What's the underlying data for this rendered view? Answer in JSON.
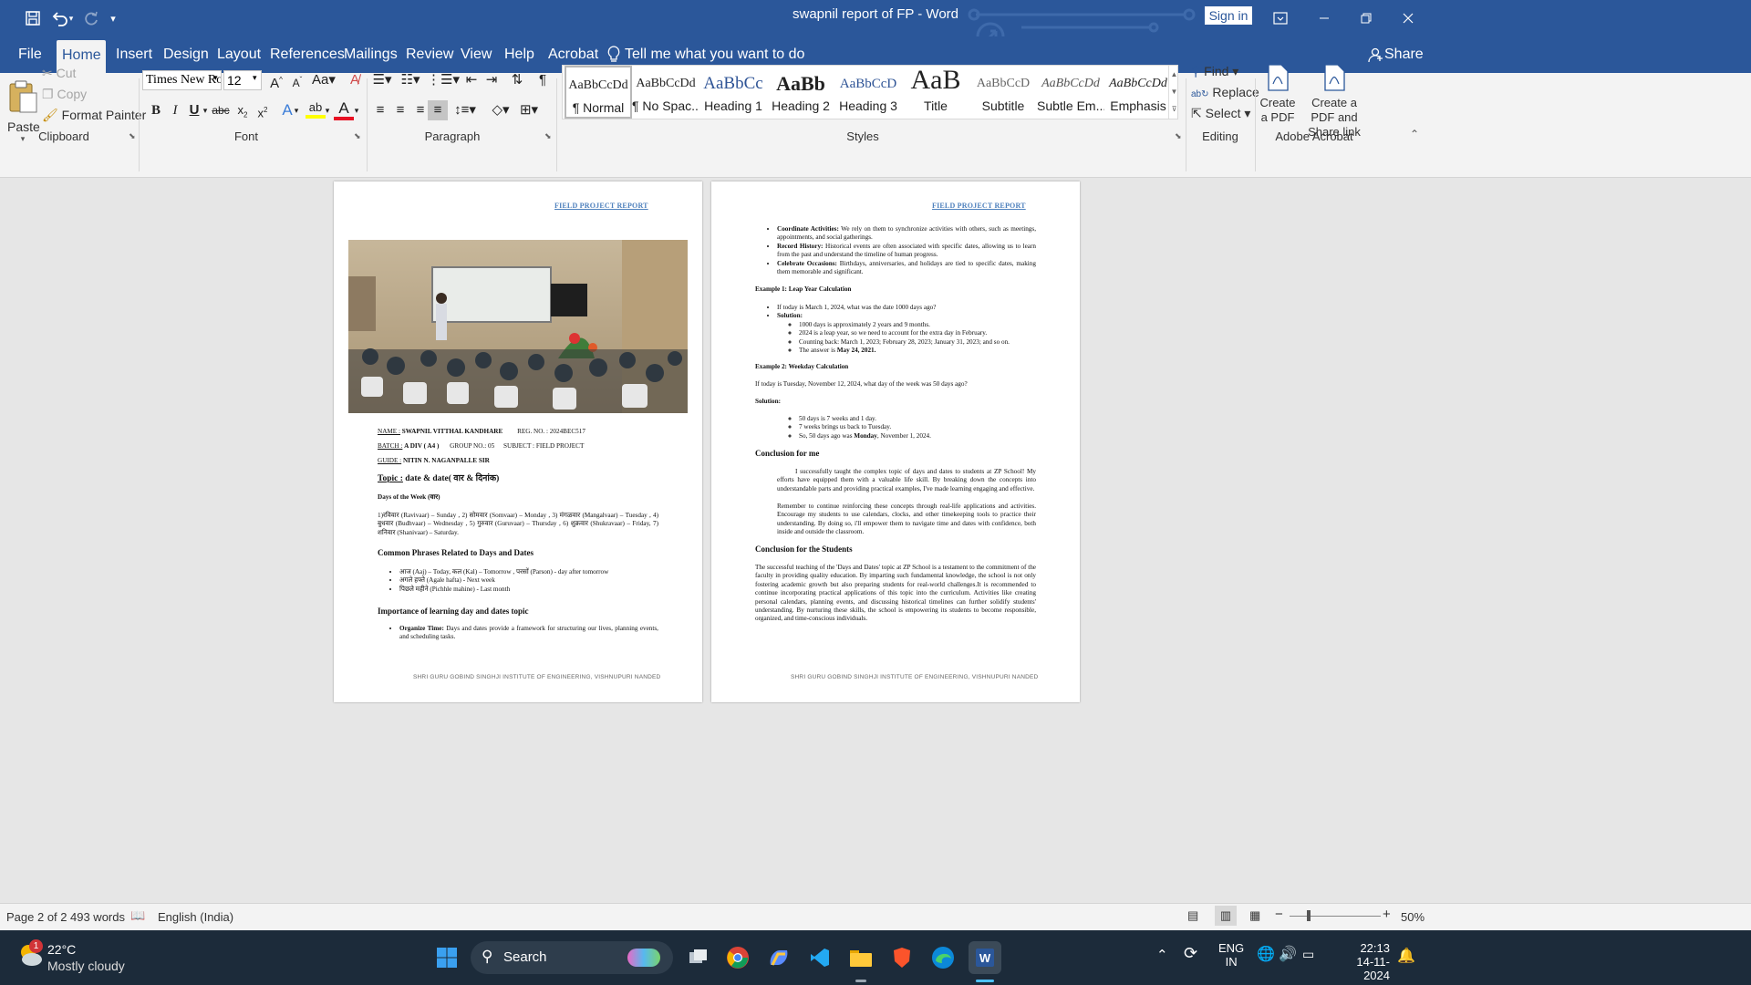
{
  "titlebar": {
    "title": "swapnil report of FP  -  Word",
    "sign_in": "Sign in"
  },
  "tabs": [
    "File",
    "Home",
    "Insert",
    "Design",
    "Layout",
    "References",
    "Mailings",
    "Review",
    "View",
    "Help",
    "Acrobat"
  ],
  "tell_me": "Tell me what you want to do",
  "share": "Share",
  "clipboard": {
    "paste": "Paste",
    "cut": "Cut",
    "copy": "Copy",
    "format_painter": "Format Painter",
    "label": "Clipboard"
  },
  "font": {
    "name": "Times New Ro",
    "size": "12",
    "label": "Font"
  },
  "paragraph": {
    "label": "Paragraph"
  },
  "styles": {
    "label": "Styles",
    "items": [
      {
        "preview": "AaBbCcDd",
        "name": "¶ Normal"
      },
      {
        "preview": "AaBbCcDd",
        "name": "¶ No Spac..."
      },
      {
        "preview": "AaBbCc",
        "name": "Heading 1"
      },
      {
        "preview": "AaBb",
        "name": "Heading 2"
      },
      {
        "preview": "AaBbCcD",
        "name": "Heading 3"
      },
      {
        "preview": "AaB",
        "name": "Title"
      },
      {
        "preview": "AaBbCcD",
        "name": "Subtitle"
      },
      {
        "preview": "AaBbCcDd",
        "name": "Subtle Em..."
      },
      {
        "preview": "AaBbCcDd",
        "name": "Emphasis"
      }
    ]
  },
  "editing": {
    "find": "Find",
    "replace": "Replace",
    "select": "Select",
    "label": "Editing"
  },
  "acrobat": {
    "create_pdf": "Create a PDF",
    "create_share": "Create a PDF and Share link",
    "label": "Adobe Acrobat"
  },
  "page1": {
    "header": "FIELD PROJECT  REPORT",
    "name_label": "NAME :",
    "name_value": "SWAPNIL VITTHAL KANDHARE",
    "reg": "REG. NO. : 2024BEC517",
    "batch_label": "BATCH :",
    "batch_value": "A DIV ( A4 )",
    "group": "GROUP NO.: 05",
    "subject": "SUBJECT : FIELD PROJECT",
    "guide_label": "GUIDE :",
    "guide_value": "NITIN N. NAGANPALLE SIR",
    "topic_label": "Topic :",
    "topic_value": "date & date( वार & दिनांक)",
    "days_heading": "Days of the Week (वार)",
    "days_text": "1)रविवार (Ravivaar) – Sunday , 2) सोमवार (Somvaar) – Monday , 3) मंगळवार (Mangalvaar) – Tuesday , 4) बुधवार (Budhvaar) – Wednesday , 5) गुरुवार (Guruvaar) – Thursday , 6) शुक्रवार (Shukravaar) – Friday, 7) शनिवार (Shanivaar) – Saturday.",
    "phrases_heading": "Common Phrases Related to Days and Dates",
    "phrases": [
      "आज (Aaj) – Today,  कल (Kal) – Tomorrow  , परसों (Parson) - day after tomorrow",
      "अगले हफ्ते (Agale hafta) - Next week",
      "पिछले महीने (Pichhle mahine) - Last month"
    ],
    "importance_heading": "Importance of learning day and dates topic",
    "organize_label": "Organize Time:",
    "organize_text": " Days and dates provide a framework for structuring our lives, planning events, and scheduling tasks.",
    "footer": "SHRI GURU GOBIND SINGHJI INSTITUTE OF ENGINEERING, VISHNUPURI NANDED"
  },
  "page2": {
    "header": "FIELD PROJECT  REPORT",
    "bullets": [
      {
        "label": "Coordinate Activities:",
        "text": " We rely on them to synchronize activities with others, such as meetings, appointments, and social gatherings."
      },
      {
        "label": "Record History:",
        "text": " Historical events are often associated with specific dates, allowing us to learn from the past and understand the timeline of human progress."
      },
      {
        "label": "Celebrate Occasions:",
        "text": " Birthdays, anniversaries, and holidays are tied to specific dates, making them memorable and significant."
      }
    ],
    "ex1_heading": "Example 1: Leap Year Calculation",
    "ex1_q": "If today is March 1, 2024, what was the date 1000 days ago?",
    "solution": "Solution:",
    "ex1_steps": [
      "1000 days is approximately 2 years and 9 months.",
      "2024 is a leap year, so we need to account for the extra day in February.",
      "Counting back: March 1, 2023; February 28, 2023; January 31, 2023; and so on."
    ],
    "ex1_answer_prefix": "The answer is ",
    "ex1_answer": "May 24, 2021.",
    "ex2_heading": "Example 2: Weekday Calculation",
    "ex2_q": "If today is Tuesday, November 12, 2024, what day of the week was 50 days ago?",
    "ex2_steps": [
      "50 days is 7 weeks and 1 day.",
      "7 weeks brings us back to Tuesday."
    ],
    "ex2_last_prefix": "So, 50 days ago was ",
    "ex2_last_bold": "Monday",
    "ex2_last_suffix": ", November 1, 2024.",
    "conc_me_heading": "Conclusion for me",
    "conc_me_p1": "I successfully taught the complex topic of days and dates to students at ZP School! My efforts have equipped them with a valuable life skill. By breaking down the concepts into understandable parts and providing practical examples, I've made learning engaging and effective.",
    "conc_me_p2": "Remember to continue reinforcing these concepts through real-life applications and activities. Encourage my students to use calendars, clocks, and other timekeeping tools to practice their understanding. By doing so, i'll empower them to navigate time and dates with confidence, both inside and outside the classroom.",
    "conc_st_heading": "Conclusion for the Students",
    "conc_st_p": "The successful teaching of the 'Days and Dates' topic at ZP School is a testament to the commitment of the faculty in providing quality education. By imparting such fundamental knowledge, the school is not only fostering academic growth but also preparing students for real-world challenges.It is recommended to continue incorporating practical applications of this topic into the curriculum. Activities like creating personal calendars, planning events, and discussing historical timelines can further solidify students' understanding. By nurturing these skills, the school is empowering its students to become responsible, organized, and time-conscious individuals.",
    "footer": "SHRI GURU GOBIND SINGHJI INSTITUTE OF ENGINEERING, VISHNUPURI NANDED"
  },
  "status": {
    "page": "Page 2 of 2",
    "words": "493 words",
    "language": "English (India)",
    "zoom": "50%"
  },
  "taskbar": {
    "temp": "22°C",
    "weather": "Mostly cloudy",
    "weather_badge": "1",
    "search": "Search",
    "lang1": "ENG",
    "lang2": "IN",
    "time": "22:13",
    "date": "14-11-2024"
  }
}
